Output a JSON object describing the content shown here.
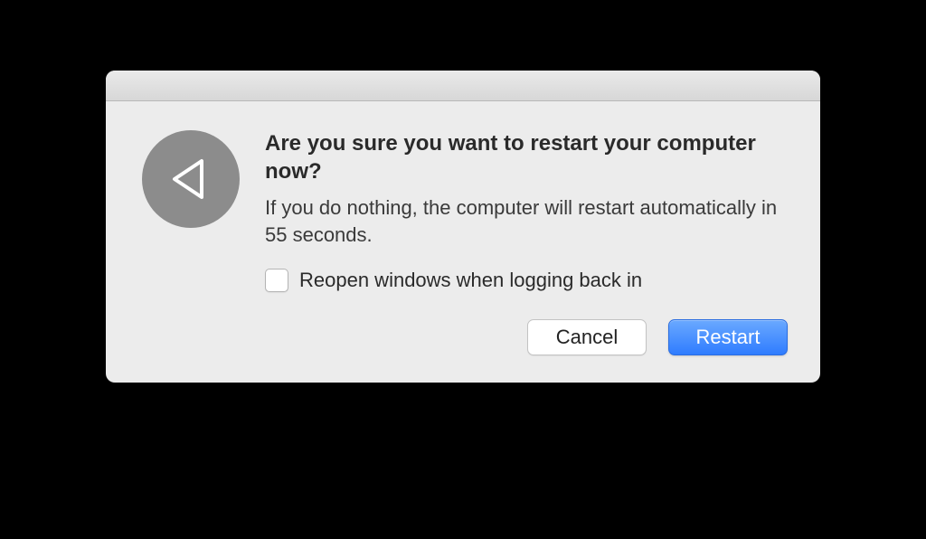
{
  "dialog": {
    "heading": "Are you sure you want to restart your computer now?",
    "message": "If you do nothing, the computer will restart automatically in 55 seconds.",
    "checkbox_label": "Reopen windows when logging back in",
    "checkbox_checked": false,
    "buttons": {
      "cancel": "Cancel",
      "confirm": "Restart"
    }
  }
}
